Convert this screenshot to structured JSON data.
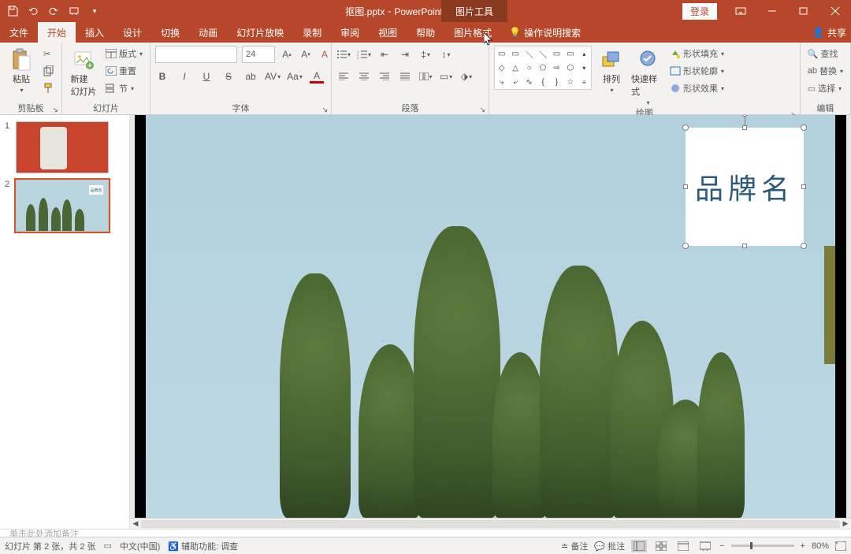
{
  "title": {
    "filename": "抠图.pptx",
    "app": "PowerPoint(产品激活失败)",
    "contextual_tool": "图片工具"
  },
  "win": {
    "login": "登录"
  },
  "tabs": {
    "file": "文件",
    "home": "开始",
    "insert": "插入",
    "design": "设计",
    "transitions": "切换",
    "animations": "动画",
    "slideshow": "幻灯片放映",
    "record": "录制",
    "review": "审阅",
    "view": "视图",
    "help": "帮助",
    "picfmt": "图片格式",
    "tellme": "操作说明搜索",
    "share": "共享"
  },
  "ribbon": {
    "clipboard": {
      "label": "剪贴板",
      "paste": "粘贴"
    },
    "slides": {
      "label": "幻灯片",
      "new": "新建\n幻灯片",
      "layout": "版式",
      "reset": "重置",
      "section": "节"
    },
    "font": {
      "label": "字体",
      "size": "24"
    },
    "paragraph": {
      "label": "段落"
    },
    "drawing": {
      "label": "绘图",
      "arrange": "排列",
      "quick": "快速样式",
      "fill": "形状填充",
      "outline": "形状轮廓",
      "effects": "形状效果"
    },
    "editing": {
      "label": "编辑",
      "find": "查找",
      "replace": "替换",
      "select": "选择"
    }
  },
  "slides_panel": {
    "n1": "1",
    "n2": "2",
    "brandlabel": "品牌名"
  },
  "canvas": {
    "brand_text": "品牌名"
  },
  "notes": {
    "placeholder": "单击此处添加备注"
  },
  "status": {
    "slide_info": "幻灯片 第 2 张，共 2 张",
    "lang": "中文(中国)",
    "accessibility": "辅助功能: 调查",
    "notes_btn": "备注",
    "comments_btn": "批注",
    "zoom": "80%"
  }
}
